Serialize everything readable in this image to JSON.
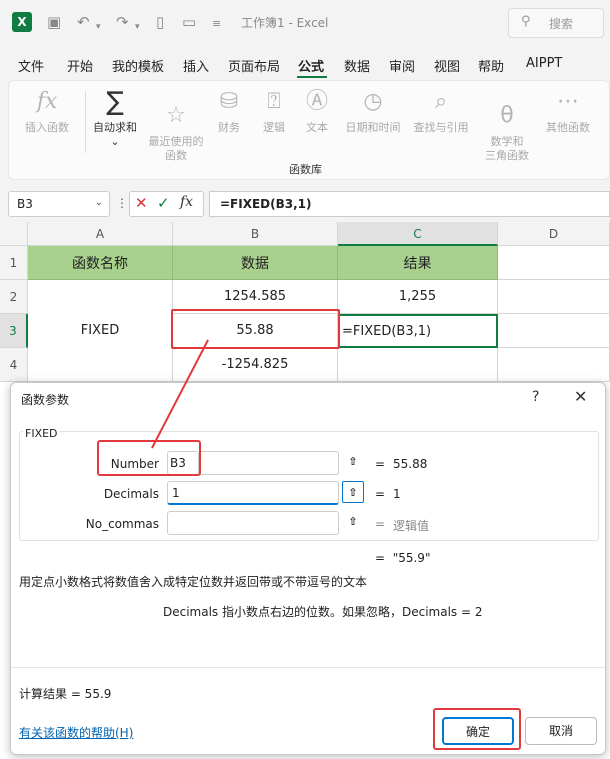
{
  "titlebar": {
    "logo": "X",
    "title": "工作簿1  -  Excel",
    "search_placeholder": "搜索",
    "icons": [
      "save-icon",
      "undo-icon",
      "redo-icon",
      "new-file-icon",
      "open-folder-icon",
      "customize-icon"
    ]
  },
  "menu": {
    "items": [
      "文件",
      "开始",
      "我的模板",
      "插入",
      "页面布局",
      "公式",
      "数据",
      "审阅",
      "视图",
      "帮助",
      "AIPPT"
    ],
    "active": "公式"
  },
  "ribbon": {
    "buttons": [
      {
        "label": "插入函数",
        "icon": "fx-icon"
      },
      {
        "label": "自动求和",
        "icon": "sigma-icon"
      },
      {
        "label": "最近使用的\n函数",
        "icon": "star-icon"
      },
      {
        "label": "财务",
        "icon": "database-icon"
      },
      {
        "label": "逻辑",
        "icon": "question-icon"
      },
      {
        "label": "文本",
        "icon": "text-icon"
      },
      {
        "label": "日期和时间",
        "icon": "clock-icon"
      },
      {
        "label": "查找与引用",
        "icon": "search-icon"
      },
      {
        "label": "数学和\n三角函数",
        "icon": "theta-icon"
      },
      {
        "label": "其他函数",
        "icon": "more-icon"
      }
    ],
    "group_label": "函数库"
  },
  "formula_bar": {
    "name_box": "B3",
    "formula": "=FIXED(B3,1)"
  },
  "sheet": {
    "columns": [
      "A",
      "B",
      "C",
      "D"
    ],
    "rows": [
      "1",
      "2",
      "3",
      "4"
    ],
    "headers": [
      "函数名称",
      "数据",
      "结果"
    ],
    "function_name": "FIXED",
    "data": [
      "1254.585",
      "55.88",
      "-1254.825"
    ],
    "results": [
      "1,255",
      "=FIXED(B3,1)",
      ""
    ]
  },
  "dialog": {
    "title": "函数参数",
    "help_glyph": "?",
    "function": "FIXED",
    "args": [
      {
        "label": "Number",
        "value": "B3",
        "result": "55.88"
      },
      {
        "label": "Decimals",
        "value": "1",
        "result": "1"
      },
      {
        "label": "No_commas",
        "value": "",
        "result": "逻辑值"
      }
    ],
    "eq": "=",
    "formula_result": "\"55.9\"",
    "description": "用定点小数格式将数值舍入成特定位数并返回带或不带逗号的文本",
    "param_description": "Decimals   指小数点右边的位数。如果忽略，Decimals = 2",
    "calc_result": "计算结果 =   55.9",
    "help_link": "有关该函数的帮助(H)",
    "ok": "确定",
    "cancel": "取消"
  },
  "colors": {
    "excel_green": "#107c41",
    "header_fill": "#a9d18e",
    "highlight_red": "#e4393c",
    "focus_blue": "#0078d4"
  }
}
